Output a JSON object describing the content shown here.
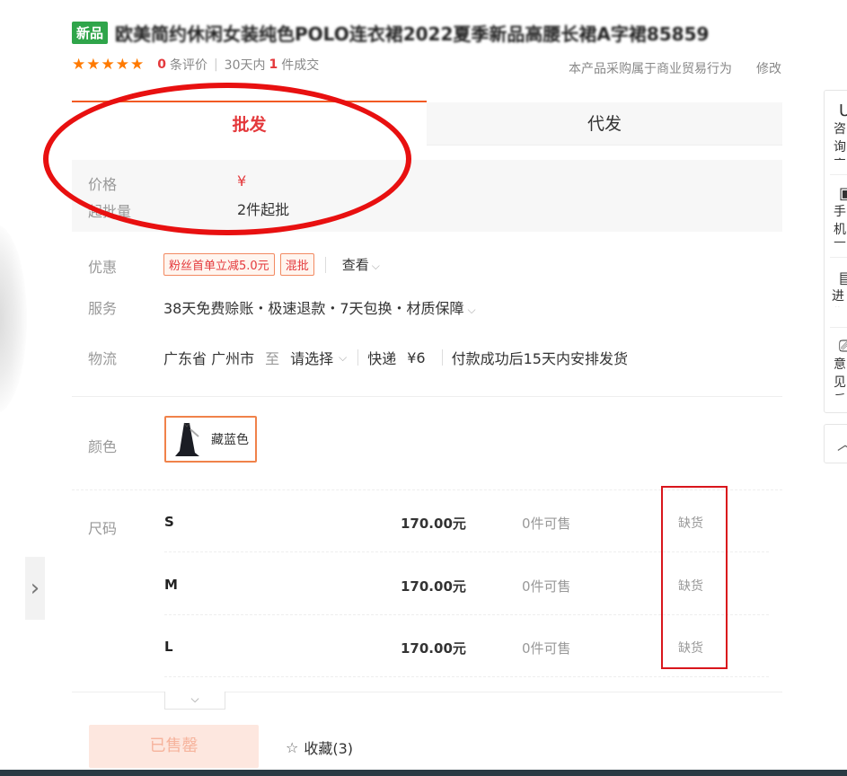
{
  "product": {
    "new_badge": "新品",
    "title": "欧美简约休闲女装纯色POLO连衣裙2022夏季新品高腰长裙A字裙85859"
  },
  "rating": {
    "stars": "★★★★★",
    "review_count": "0",
    "review_label": "条评价",
    "days_label": "30天内",
    "deal_count": "1",
    "deal_label": "件成交"
  },
  "trade_note": "本产品采购属于商业贸易行为",
  "edit_label": "修改",
  "tabs": {
    "wholesale": "批发",
    "dropship": "代发"
  },
  "price": {
    "label": "价格",
    "value": "¥",
    "min_qty_label": "起批量",
    "min_qty_value": "2件起批"
  },
  "promo": {
    "label": "优惠",
    "tags": [
      "粉丝首单立减5.0元",
      "混批"
    ],
    "view_label": "查看"
  },
  "service": {
    "label": "服务",
    "text": "38天免费赊账・极速退款・7天包换・材质保障"
  },
  "logistics": {
    "label": "物流",
    "from": "广东省 广州市",
    "to_label": "至",
    "select_label": "请选择",
    "express_label": "快递",
    "express_fee": "¥6",
    "ship_note": "付款成功后15天内安排发货"
  },
  "color": {
    "label": "颜色",
    "option": "藏蓝色"
  },
  "size": {
    "label": "尺码",
    "rows": [
      {
        "name": "S",
        "price": "170.00元",
        "stock": "0件可售",
        "status": "缺货"
      },
      {
        "name": "M",
        "price": "170.00元",
        "stock": "0件可售",
        "status": "缺货"
      },
      {
        "name": "L",
        "price": "170.00元",
        "stock": "0件可售",
        "status": "缺货"
      }
    ]
  },
  "actions": {
    "sold_out": "已售罄",
    "favorite": "收藏(3)"
  },
  "side_panel": {
    "items": [
      {
        "icon": "headset-icon",
        "text": "咨询客服"
      },
      {
        "icon": "qrcode-icon",
        "text": "手机下单"
      },
      {
        "icon": "clipboard-icon",
        "text": "进货单"
      },
      {
        "icon": "feedback-icon",
        "text": "意见反馈"
      }
    ]
  },
  "colors": {
    "accent": "#e4393c",
    "tab_border": "#f25a23",
    "annotation_red": "#e81010",
    "badge_green": "#2fa54a"
  }
}
